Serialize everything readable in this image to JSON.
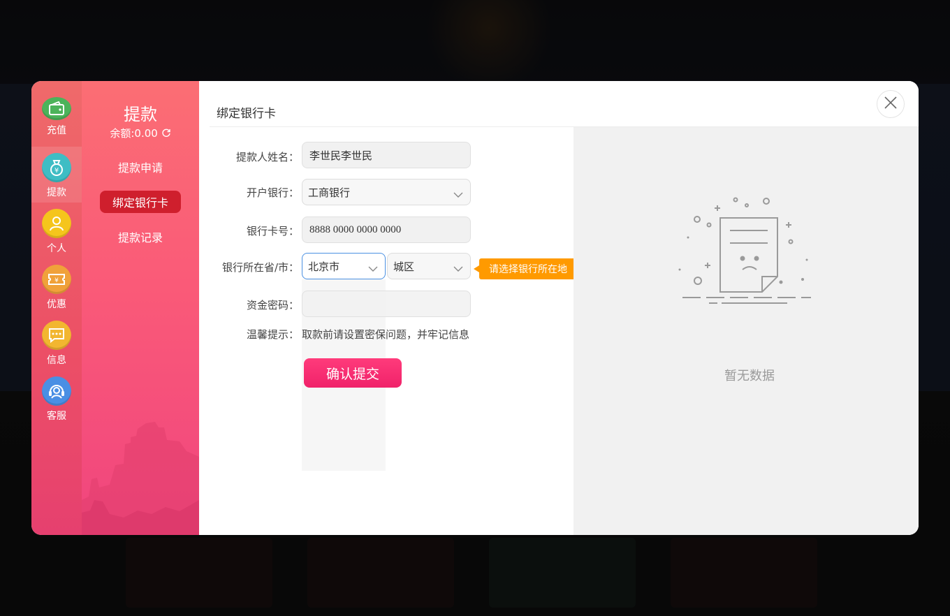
{
  "sidebar": {
    "items": [
      {
        "label": "充值",
        "icon": "wallet-icon",
        "color": "#4cb35a"
      },
      {
        "label": "提款",
        "icon": "money-bag-icon",
        "color": "#3fbdc4"
      },
      {
        "label": "个人",
        "icon": "user-icon",
        "color": "#f5c51c"
      },
      {
        "label": "优惠",
        "icon": "ticket-icon",
        "color": "#f0a13a"
      },
      {
        "label": "信息",
        "icon": "message-icon",
        "color": "#f2b630"
      },
      {
        "label": "客服",
        "icon": "headset-icon",
        "color": "#4a8fe4"
      }
    ],
    "active_index": 1
  },
  "submenu": {
    "title": "提款",
    "balance": "余额:0.00",
    "links": [
      "提款申请",
      "绑定银行卡",
      "提款记录"
    ],
    "active_index": 1
  },
  "form": {
    "header": "绑定银行卡",
    "name_label": "提款人姓名：",
    "name_value": "李世民李世民",
    "bank_label": "开户银行：",
    "bank_value": "工商银行",
    "card_label": "银行卡号：",
    "card_value": "8888 0000 0000 0000",
    "location_label": "银行所在省/市：",
    "province_value": "北京市",
    "city_value": "城区",
    "password_label": "资金密码：",
    "hint_label": "温馨提示：",
    "hint_text": "取款前请设置密保问题，并牢记信息",
    "submit_label": "确认提交"
  },
  "tooltip": "请选择银行所在地",
  "empty_state": {
    "text": "暂无数据",
    "icon": "empty-document-icon"
  },
  "colors": {
    "accent": "#f0226a",
    "active_link": "#cf1f2d",
    "tooltip": "#ff9a00"
  }
}
